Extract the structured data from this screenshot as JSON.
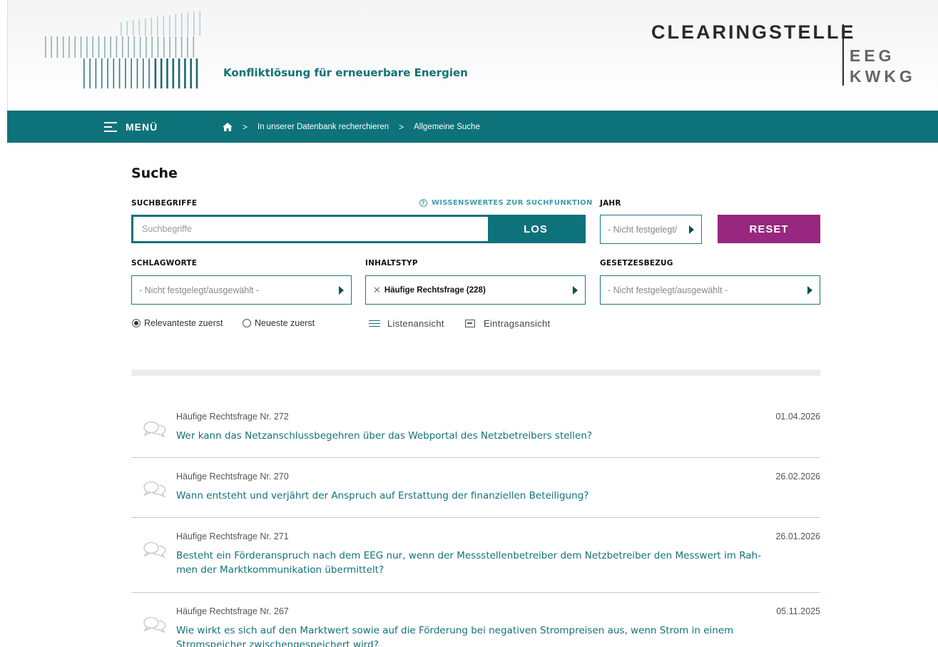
{
  "header": {
    "tagline": "Konfliktlösung für erneuerbare Energien",
    "brand_main": "CLEARINGSTELLE",
    "brand_sub_1": "EEG",
    "brand_sub_2": "KWKG"
  },
  "nav": {
    "menu_label": "MENÜ",
    "breadcrumb": [
      "In unserer Datenbank recherchieren",
      "Allgemeine Suche"
    ],
    "separator": ">"
  },
  "search": {
    "title": "Suche",
    "terms_label": "SUCHBEGRIFFE",
    "help_link": "WISSENSWERTES ZUR SUCHFUNKTION",
    "help_icon": "?",
    "input_placeholder": "Suchbegriffe",
    "input_value": "",
    "submit_label": "LOS",
    "year_label": "JAHR",
    "year_value": "- Nicht festgelegt/",
    "reset_label": "RESET",
    "keywords_label": "SCHLAGWORTE",
    "keywords_value": "- Nicht festgelegt/ausgewählt -",
    "content_type_label": "INHALTSTYP",
    "content_type_value": "Häufige Rechtsfrage (228)",
    "content_type_clear": "✕",
    "law_label": "GESETZESBEZUG",
    "law_value": "- Nicht festgelegt/ausgewählt -",
    "sort_relevant": "Relevanteste zuerst",
    "sort_newest": "Neueste zuerst",
    "view_list": "Listenansicht",
    "view_entry": "Eintragsansicht"
  },
  "results": [
    {
      "meta": "Häufige Rechtsfrage Nr. 272",
      "date": "01.04.2026",
      "title": "Wer kann das Netzanschlussbegehren über das Webportal des Netzbetreibers stellen?"
    },
    {
      "meta": "Häufige Rechtsfrage Nr. 270",
      "date": "26.02.2026",
      "title": "Wann entsteht und verjährt der Anspruch auf Erstattung der finanziellen Beteiligung?"
    },
    {
      "meta": "Häufige Rechtsfrage Nr. 271",
      "date": "26.01.2026",
      "title": "Besteht ein Förderanspruch nach dem EEG nur, wenn der Messstellenbetreiber dem Netzbetreiber den Messwert im Rah-men der Marktkommunikation übermittelt?"
    },
    {
      "meta": "Häufige Rechtsfrage Nr. 267",
      "date": "05.11.2025",
      "title": "Wie wirkt es sich auf den Marktwert sowie auf die Förderung bei negativen Strompreisen aus, wenn Strom in einem Stromspeicher zwischengespeichert wird?"
    }
  ],
  "colors": {
    "primary": "#0e727a",
    "accent": "#97277f",
    "link": "#127278"
  }
}
